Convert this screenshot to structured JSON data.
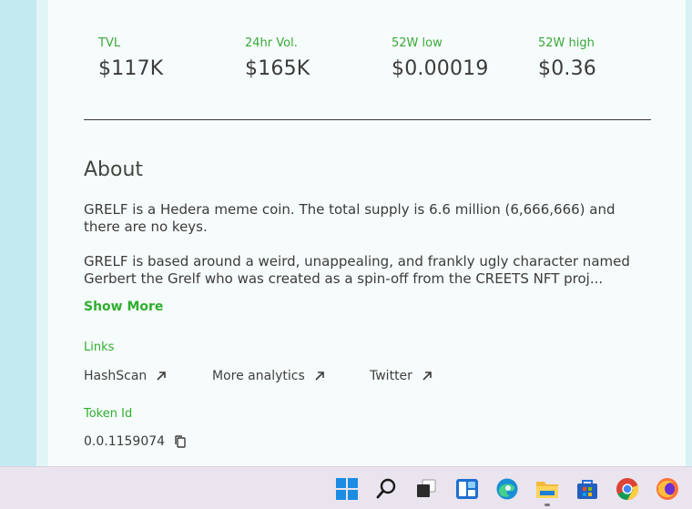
{
  "stats": [
    {
      "label": "TVL",
      "value": "$117K"
    },
    {
      "label": "24hr Vol.",
      "value": "$165K"
    },
    {
      "label": "52W low",
      "value": "$0.00019"
    },
    {
      "label": "52W high",
      "value": "$0.36"
    }
  ],
  "about": {
    "title": "About",
    "paragraph1_line1": "GRELF is a Hedera meme coin. The total supply is 6.6 million (6,666,666) and",
    "paragraph1_line2": "there are no keys.",
    "paragraph2_line1": "GRELF is based around a weird, unappealing, and frankly ugly character named",
    "paragraph2_line2": "Gerbert the Grelf who was created as a spin-off from the CREETS NFT proj...",
    "show_more": "Show More"
  },
  "links": {
    "label": "Links",
    "items": [
      "HashScan",
      "More analytics",
      "Twitter"
    ]
  },
  "token": {
    "label": "Token Id",
    "value": "0.0.1159074"
  },
  "taskbar": {
    "icons": [
      "windows-start-icon",
      "search-icon",
      "task-view-icon",
      "widgets-icon",
      "edge-icon",
      "file-explorer-icon",
      "store-icon",
      "chrome-icon",
      "firefox-icon"
    ]
  },
  "colors": {
    "accent_green": "#2fae2f",
    "card_background": "#f6fcfb",
    "page_background": "#c8ecf2",
    "taskbar": "#eae4ee"
  }
}
